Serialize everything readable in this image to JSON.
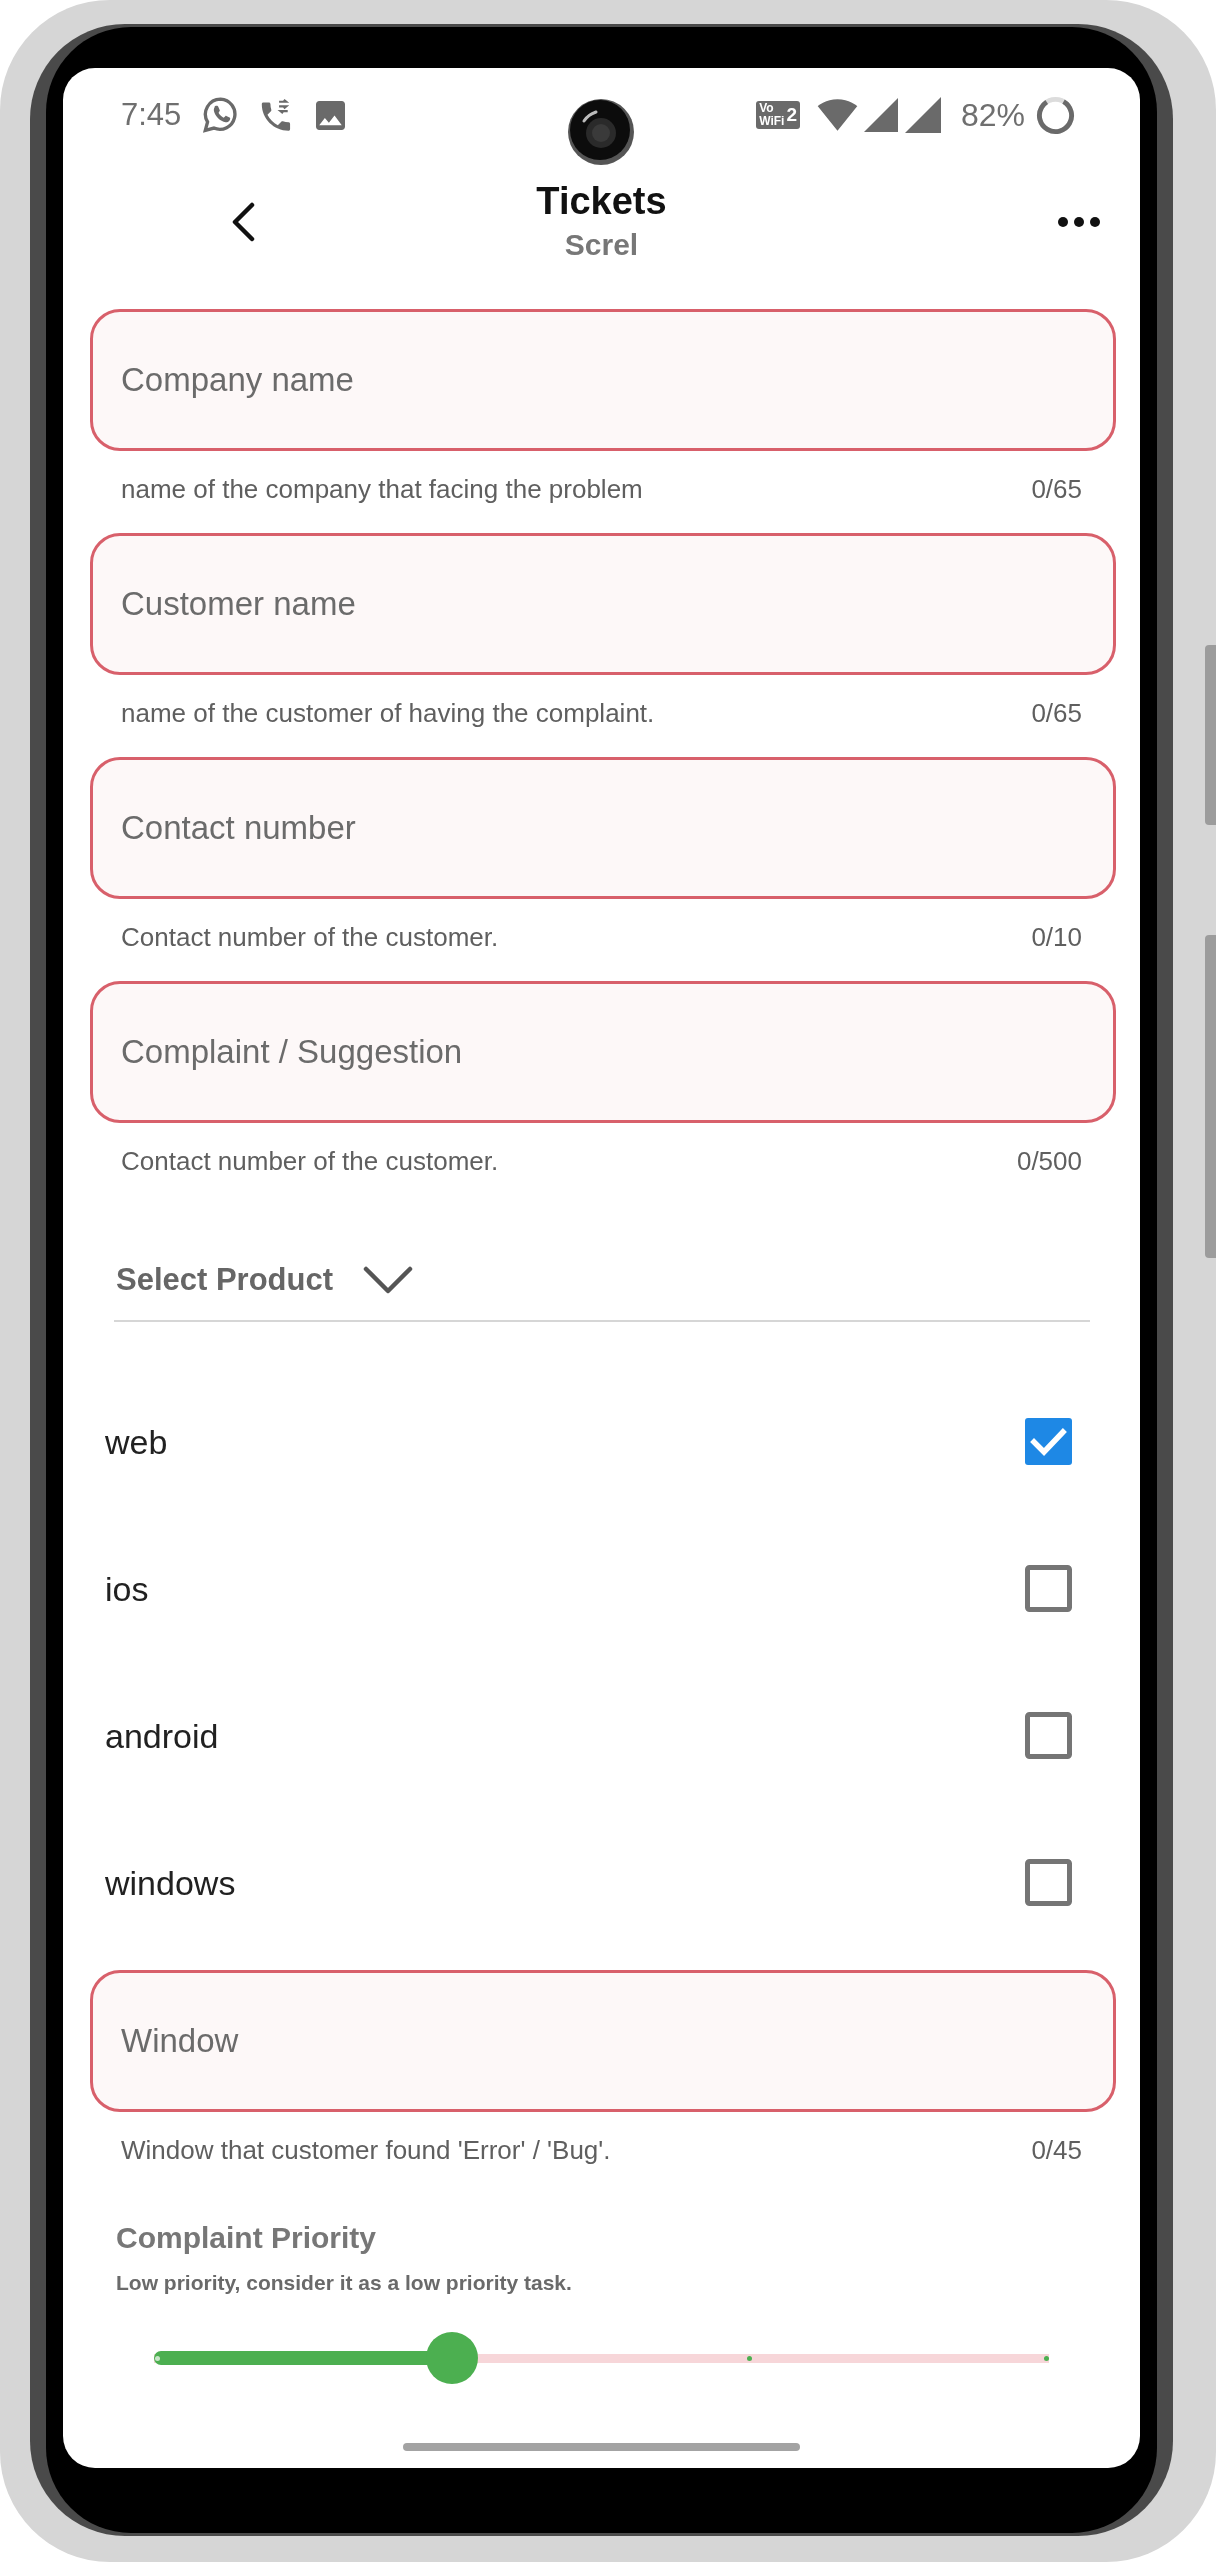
{
  "status_bar": {
    "time": "7:45",
    "vowifi_badge": {
      "lines": [
        "Vo",
        "WiFi"
      ],
      "sim": "2"
    },
    "battery": "82%"
  },
  "header": {
    "title": "Tickets",
    "subtitle": "Screl"
  },
  "fields": [
    {
      "placeholder": "Company name",
      "helper": "name of the company that facing the problem",
      "counter": "0/65"
    },
    {
      "placeholder": "Customer name",
      "helper": "name of the customer of having the complaint.",
      "counter": "0/65"
    },
    {
      "placeholder": "Contact number",
      "helper": "Contact number of the customer.",
      "counter": "0/10"
    },
    {
      "placeholder": "Complaint / Suggestion",
      "helper": "Contact number of the customer.",
      "counter": "0/500"
    }
  ],
  "product_select": {
    "label": "Select Product"
  },
  "products": [
    {
      "label": "web",
      "checked": true
    },
    {
      "label": "ios",
      "checked": false
    },
    {
      "label": "android",
      "checked": false
    },
    {
      "label": "windows",
      "checked": false
    }
  ],
  "window_field": {
    "placeholder": "Window",
    "helper": "Window that customer found 'Error' / 'Bug'.",
    "counter": "0/45"
  },
  "priority": {
    "title": "Complaint Priority",
    "description": "Low priority, consider it as a low priority task.",
    "level": 0.333
  }
}
